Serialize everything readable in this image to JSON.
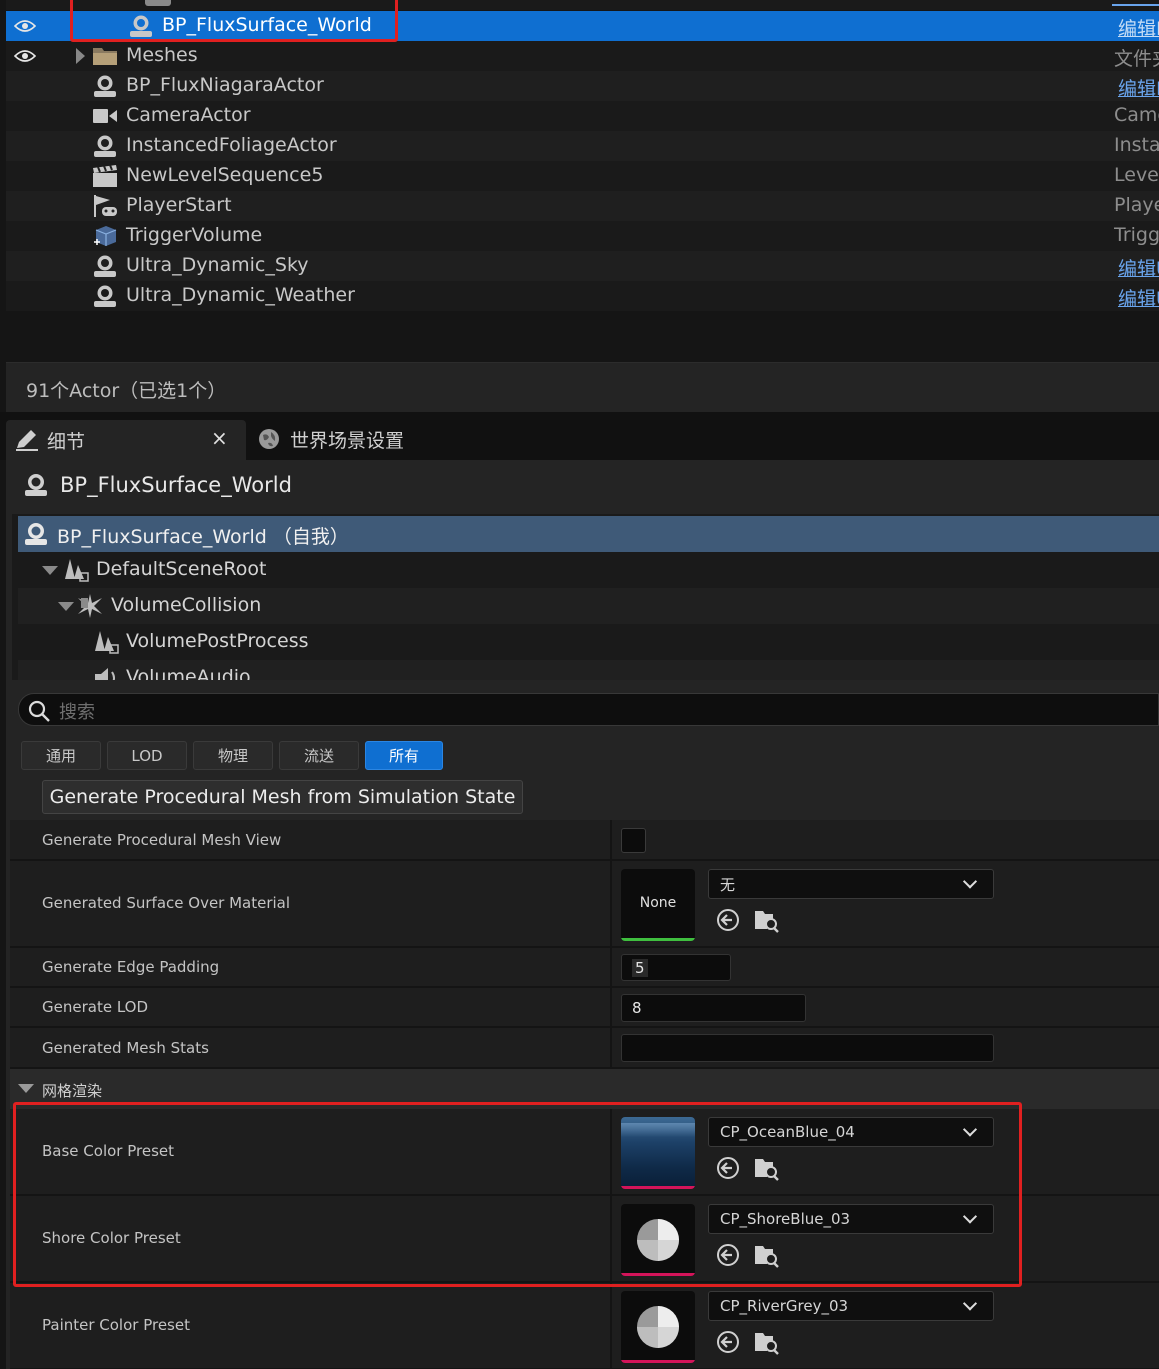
{
  "outliner": {
    "rows": [
      {
        "label": "BP_FluxSurface_World",
        "type": "编辑B",
        "type_link": true,
        "selected": true,
        "eye": true,
        "icon": "actor-icon"
      },
      {
        "label": "Meshes",
        "type": "文件夹",
        "type_link": false,
        "selected": false,
        "eye": true,
        "icon": "folder-icon"
      },
      {
        "label": "BP_FluxNiagaraActor",
        "type": "编辑B",
        "type_link": true,
        "selected": false,
        "eye": false,
        "icon": "actor-icon"
      },
      {
        "label": "CameraActor",
        "type": "CameraActor",
        "type_link": false,
        "selected": false,
        "eye": false,
        "icon": "camera-icon"
      },
      {
        "label": "InstancedFoliageActor",
        "type": "InstancedFoliageActor",
        "type_link": false,
        "selected": false,
        "eye": false,
        "icon": "actor-icon"
      },
      {
        "label": "NewLevelSequence5",
        "type": "LevelSequenceActor",
        "type_link": false,
        "selected": false,
        "eye": false,
        "icon": "clapper-icon"
      },
      {
        "label": "PlayerStart",
        "type": "PlayerStart",
        "type_link": false,
        "selected": false,
        "eye": false,
        "icon": "player-start-icon"
      },
      {
        "label": "TriggerVolume",
        "type": "TriggerVolume",
        "type_link": false,
        "selected": false,
        "eye": false,
        "icon": "trigger-volume-icon"
      },
      {
        "label": "Ultra_Dynamic_Sky",
        "type": "编辑U",
        "type_link": true,
        "selected": false,
        "eye": false,
        "icon": "actor-icon"
      },
      {
        "label": "Ultra_Dynamic_Weather",
        "type": "编辑U",
        "type_link": true,
        "selected": false,
        "eye": false,
        "icon": "actor-icon"
      }
    ],
    "status": "91个Actor（已选1个）"
  },
  "tabs": {
    "details": "细节",
    "world_settings": "世界场景设置"
  },
  "details": {
    "actor_name": "BP_FluxSurface_World",
    "components": [
      {
        "label": "BP_FluxSurface_World （自我）",
        "icon": "actor-icon"
      },
      {
        "label": "DefaultSceneRoot",
        "icon": "scene-root-icon"
      },
      {
        "label": "VolumeCollision",
        "icon": "collision-icon"
      },
      {
        "label": "VolumePostProcess",
        "icon": "scene-root-icon"
      },
      {
        "label": "VolumeAudio",
        "icon": "audio-icon"
      }
    ],
    "search_placeholder": "搜索",
    "filters": [
      "通用",
      "LOD",
      "物理",
      "流送",
      "所有"
    ],
    "generate_button": "Generate Procedural Mesh from Simulation State",
    "props": {
      "mesh_view_label": "Generate Procedural Mesh View",
      "surface_material_label": "Generated Surface Over Material",
      "surface_material_thumb": "None",
      "surface_material_value": "无",
      "edge_padding_label": "Generate Edge Padding",
      "edge_padding_value": "5",
      "lod_label": "Generate LOD",
      "lod_value": "8",
      "mesh_stats_label": "Generated Mesh Stats",
      "mesh_stats_value": ""
    },
    "section_title": "网格渲染",
    "presets": [
      {
        "label": "Base Color Preset",
        "value": "CP_OceanBlue_04",
        "thumb": "ocean"
      },
      {
        "label": "Shore Color Preset",
        "value": "CP_ShoreBlue_03",
        "thumb": "curve"
      },
      {
        "label": "Painter Color Preset",
        "value": "CP_RiverGrey_03",
        "thumb": "curve"
      }
    ]
  },
  "colors": {
    "selection": "#0f6fd1",
    "highlight_box": "#e02020",
    "material_green": "#3fbf3f",
    "curve_pink": "#d4145a"
  }
}
